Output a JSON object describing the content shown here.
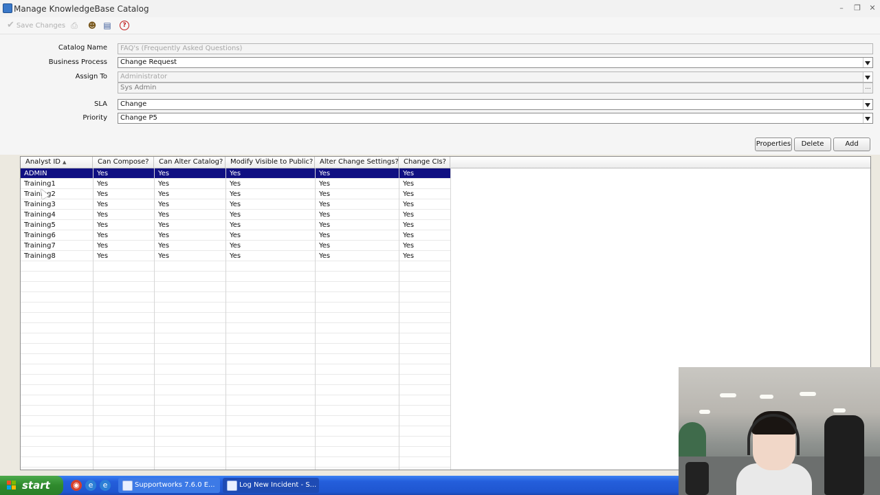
{
  "window": {
    "title": "Manage KnowledgeBase Catalog",
    "controls": [
      "minimize",
      "restore",
      "close"
    ]
  },
  "toolbar": {
    "save_label": "Save Changes",
    "icons": [
      "checkmark-icon",
      "print-icon",
      "users-icon",
      "select-icon",
      "help-icon"
    ]
  },
  "form": {
    "catalog_name": {
      "label": "Catalog Name",
      "value": "FAQ's (Frequently Asked Questions)"
    },
    "business_process": {
      "label": "Business Process",
      "value": "Change Request"
    },
    "assign_to": {
      "label": "Assign To",
      "group_value": "Administrator",
      "user_value": "Sys Admin",
      "browse_label": "..."
    },
    "sla": {
      "label": "SLA",
      "value": "Change"
    },
    "priority": {
      "label": "Priority",
      "value": "Change P5"
    }
  },
  "actions": {
    "properties_label": "Properties",
    "delete_label": "Delete",
    "add_label": "Add"
  },
  "table": {
    "columns": [
      "Analyst ID",
      "Can Compose?",
      "Can Alter Catalog?",
      "Modify Visible to Public?",
      "Alter Change Settings?",
      "Change CIs?"
    ],
    "sort_column": "Analyst ID",
    "sort_direction": "ascending",
    "selected_row": 0,
    "rows": [
      [
        "ADMIN",
        "Yes",
        "Yes",
        "Yes",
        "Yes",
        "Yes"
      ],
      [
        "Training1",
        "Yes",
        "Yes",
        "Yes",
        "Yes",
        "Yes"
      ],
      [
        "Training2",
        "Yes",
        "Yes",
        "Yes",
        "Yes",
        "Yes"
      ],
      [
        "Training3",
        "Yes",
        "Yes",
        "Yes",
        "Yes",
        "Yes"
      ],
      [
        "Training4",
        "Yes",
        "Yes",
        "Yes",
        "Yes",
        "Yes"
      ],
      [
        "Training5",
        "Yes",
        "Yes",
        "Yes",
        "Yes",
        "Yes"
      ],
      [
        "Training6",
        "Yes",
        "Yes",
        "Yes",
        "Yes",
        "Yes"
      ],
      [
        "Training7",
        "Yes",
        "Yes",
        "Yes",
        "Yes",
        "Yes"
      ],
      [
        "Training8",
        "Yes",
        "Yes",
        "Yes",
        "Yes",
        "Yes"
      ]
    ]
  },
  "taskbar": {
    "start_label": "start",
    "quick_launch": [
      "chrome-icon",
      "ie-icon",
      "ie-icon"
    ],
    "tasks": [
      {
        "label": "Supportworks 7.6.0 E...",
        "active": false
      },
      {
        "label": "Log New Incident - S...",
        "active": true
      }
    ]
  },
  "colors": {
    "selection": "#101082",
    "taskbar": "#245edb",
    "start_button": "#2f8a2d"
  }
}
